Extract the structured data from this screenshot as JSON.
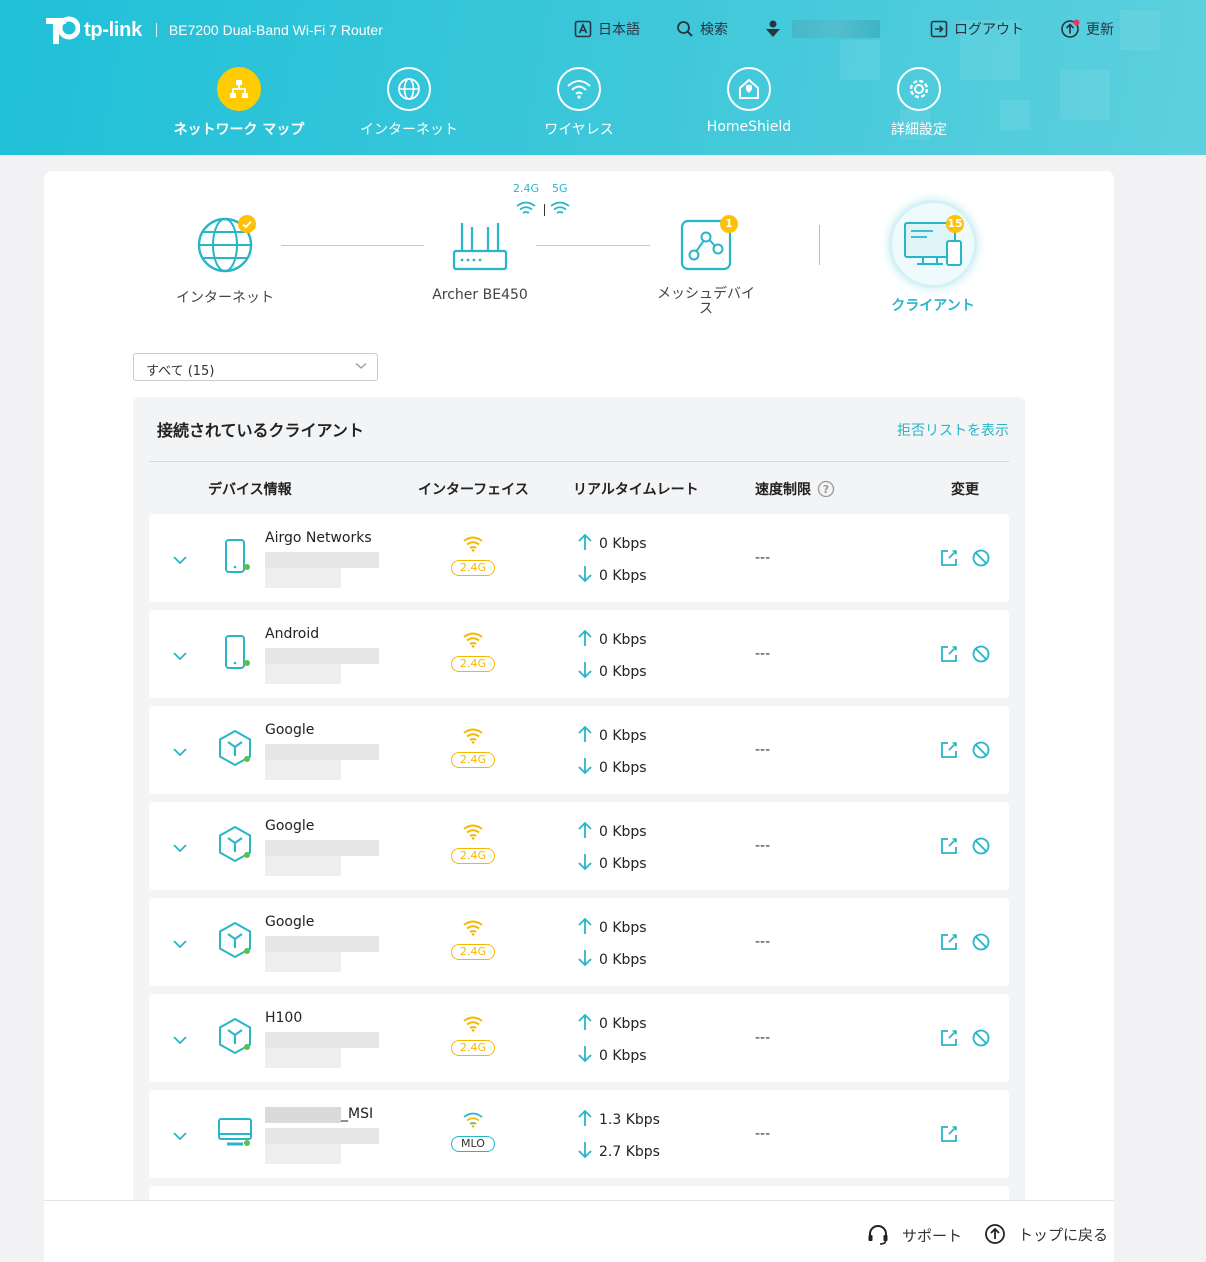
{
  "header": {
    "brand": "tp-link",
    "model": "BE7200 Dual-Band Wi-Fi 7 Router",
    "topbar": {
      "language": "日本語",
      "search": "検索",
      "logout": "ログアウト",
      "update": "更新"
    },
    "nav": [
      {
        "label": "ネットワーク マップ",
        "icon": "network-map-icon",
        "active": true
      },
      {
        "label": "インターネット",
        "icon": "globe-icon",
        "active": false
      },
      {
        "label": "ワイヤレス",
        "icon": "wifi-icon",
        "active": false
      },
      {
        "label": "HomeShield",
        "icon": "home-shield-icon",
        "active": false
      },
      {
        "label": "詳細設定",
        "icon": "gear-icon",
        "active": false
      }
    ]
  },
  "topology": {
    "internet": "インターネット",
    "router": "Archer BE450",
    "band_24": "2.4G",
    "band_5": "5G",
    "mesh": "メッシュデバイス",
    "mesh_count": "1",
    "clients": "クライアント",
    "clients_count": "15"
  },
  "filter": {
    "selected": "すべて (15)"
  },
  "panel": {
    "title": "接続されているクライアント",
    "blocklist_link": "拒否リストを表示",
    "columns": {
      "device": "デバイス情報",
      "interface": "インターフェイス",
      "rate": "リアルタイムレート",
      "limit": "速度制限",
      "edit": "変更"
    }
  },
  "clients": [
    {
      "name": "Airgo Networks",
      "type": "phone",
      "iface": "2.4G",
      "up": "0 Kbps",
      "down": "0 Kbps",
      "limit": "---",
      "block": true
    },
    {
      "name": "Android",
      "type": "phone",
      "iface": "2.4G",
      "up": "0 Kbps",
      "down": "0 Kbps",
      "limit": "---",
      "block": true
    },
    {
      "name": "Google",
      "type": "iot",
      "iface": "2.4G",
      "up": "0 Kbps",
      "down": "0 Kbps",
      "limit": "---",
      "block": true
    },
    {
      "name": "Google",
      "type": "iot",
      "iface": "2.4G",
      "up": "0 Kbps",
      "down": "0 Kbps",
      "limit": "---",
      "block": true
    },
    {
      "name": "Google",
      "type": "iot",
      "iface": "2.4G",
      "up": "0 Kbps",
      "down": "0 Kbps",
      "limit": "---",
      "block": true
    },
    {
      "name": "H100",
      "type": "iot",
      "iface": "2.4G",
      "up": "0 Kbps",
      "down": "0 Kbps",
      "limit": "---",
      "block": true
    },
    {
      "name": "_MSI",
      "type": "pc",
      "iface": "MLO",
      "up": "1.3 Kbps",
      "down": "2.7 Kbps",
      "limit": "---",
      "block": false
    }
  ],
  "footer": {
    "support": "サポート",
    "back_to_top": "トップに戻る"
  },
  "colors": {
    "header_bg": "#2fc3d9",
    "accent": "#27b6c8",
    "active_nav": "#ffcc00",
    "band_24": "#f5b800",
    "online": "#5cc04a"
  }
}
